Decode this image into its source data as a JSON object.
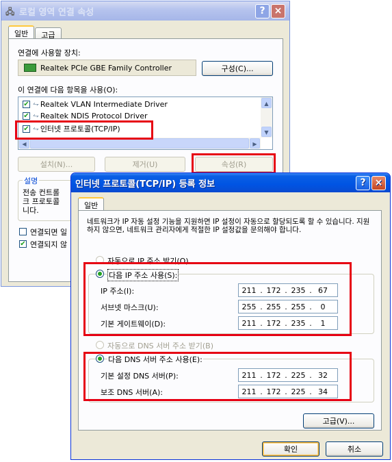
{
  "back_window": {
    "title": "로컬 영역 연결 속성",
    "help_glyph": "?",
    "close_glyph": "×",
    "tabs": [
      "일반",
      "고급"
    ],
    "connect_using_label": "연결에 사용할 장치:",
    "adapter_name": "Realtek PCIe GBE Family Controller",
    "configure_button": "구성(C)...",
    "items_label": "이 연결에 다음 항목을 사용(O):",
    "items": [
      {
        "label": "Realtek VLAN Intermediate Driver",
        "checked": true
      },
      {
        "label": "Realtek NDIS Protocol Driver",
        "checked": true
      },
      {
        "label": "인터넷 프로토콜(TCP/IP)",
        "checked": true
      }
    ],
    "install_button": "설치(N)...",
    "uninstall_button": "제거(U)",
    "properties_button": "속성(R)",
    "description_group": "설명",
    "description_lines": [
      "전송 컨트롤",
      "크 프로토콜",
      "니다."
    ],
    "show_icon_label": "연결되면 일",
    "notify_label": "연결되지 않"
  },
  "front_window": {
    "title": "인터넷 프로토콜(TCP/IP) 등록 정보",
    "help_glyph": "?",
    "close_glyph": "×",
    "tab": "일반",
    "intro": "네트워크가 IP 자동 설정 기능을 지원하면 IP 설정이 자동으로 할당되도록 할 수 있습니다. 지원하지 않으면, 네트워크 관리자에게 적절한 IP 설정값을 문의해야 합니다.",
    "auto_ip_label": "자동으로 IP 주소 받기(O)",
    "manual_ip_label": "다음 IP 주소 사용(S):",
    "ip_label": "IP 주소(I):",
    "ip_value": [
      "211",
      "172",
      "235",
      "67"
    ],
    "subnet_label": "서브넷 마스크(U):",
    "subnet_value": [
      "255",
      "255",
      "255",
      "0"
    ],
    "gateway_label": "기본 게이트웨이(D):",
    "gateway_value": [
      "211",
      "172",
      "235",
      "1"
    ],
    "auto_dns_label": "자동으로 DNS 서버 주소 받기(B)",
    "manual_dns_label": "다음 DNS 서버 주소 사용(E):",
    "preferred_dns_label": "기본 설정 DNS 서버(P):",
    "preferred_dns_value": [
      "211",
      "172",
      "225",
      "32"
    ],
    "alternate_dns_label": "보조 DNS 서버(A):",
    "alternate_dns_value": [
      "211",
      "172",
      "225",
      "34"
    ],
    "advanced_button": "고급(V)...",
    "ok_button": "확인",
    "cancel_button": "취소"
  },
  "colors": {
    "highlight": "#e60012",
    "xp_blue": "#0054e3"
  }
}
